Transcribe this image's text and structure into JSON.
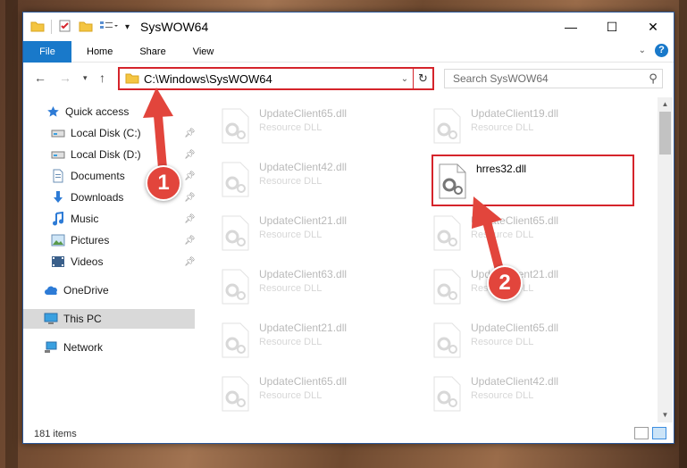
{
  "window": {
    "title": "SysWOW64",
    "controls": {
      "minimize": "—",
      "maximize": "☐",
      "close": "✕"
    }
  },
  "ribbon": {
    "tabs": [
      "File",
      "Home",
      "Share",
      "View"
    ],
    "help": "?"
  },
  "address": {
    "path": "C:\\Windows\\SysWOW64",
    "search_placeholder": "Search SysWOW64"
  },
  "nav": {
    "items": [
      {
        "label": "Quick access",
        "icon": "star-icon",
        "pinned": false
      },
      {
        "label": "Local Disk (C:)",
        "icon": "drive-icon",
        "pinned": true
      },
      {
        "label": "Local Disk (D:)",
        "icon": "drive-icon",
        "pinned": true
      },
      {
        "label": "Documents",
        "icon": "documents-icon",
        "pinned": true
      },
      {
        "label": "Downloads",
        "icon": "download-icon",
        "pinned": true
      },
      {
        "label": "Music",
        "icon": "music-icon",
        "pinned": true
      },
      {
        "label": "Pictures",
        "icon": "pictures-icon",
        "pinned": true
      },
      {
        "label": "Videos",
        "icon": "videos-icon",
        "pinned": true
      },
      {
        "label": "OneDrive",
        "icon": "cloud-icon",
        "pinned": false
      },
      {
        "label": "This PC",
        "icon": "computer-icon",
        "pinned": false,
        "selected": true
      },
      {
        "label": "Network",
        "icon": "network-icon",
        "pinned": false
      }
    ]
  },
  "files": {
    "col1": [
      {
        "name": "UpdateClient65.dll",
        "type": "Resource DLL"
      },
      {
        "name": "UpdateClient42.dll",
        "type": "Resource DLL"
      },
      {
        "name": "UpdateClient21.dll",
        "type": "Resource DLL"
      },
      {
        "name": "UpdateClient63.dll",
        "type": "Resource DLL"
      },
      {
        "name": "UpdateClient21.dll",
        "type": "Resource DLL"
      },
      {
        "name": "UpdateClient65.dll",
        "type": "Resource DLL"
      }
    ],
    "col2": [
      {
        "name": "UpdateClient19.dll",
        "type": "Resource DLL"
      },
      {
        "name": "hrres32.dll",
        "type": "",
        "highlighted": true
      },
      {
        "name": "UpdateClient65.dll",
        "type": "Resource DLL"
      },
      {
        "name": "UpdateClient21.dll",
        "type": "Resource DLL"
      },
      {
        "name": "UpdateClient65.dll",
        "type": "Resource DLL"
      },
      {
        "name": "UpdateClient42.dll",
        "type": "Resource DLL"
      }
    ]
  },
  "status": {
    "count": "181 items"
  },
  "annotations": {
    "step1": "1",
    "step2": "2"
  },
  "colors": {
    "accent": "#1979ca",
    "highlight_red": "#d5242b",
    "badge_red": "#e2453c"
  }
}
